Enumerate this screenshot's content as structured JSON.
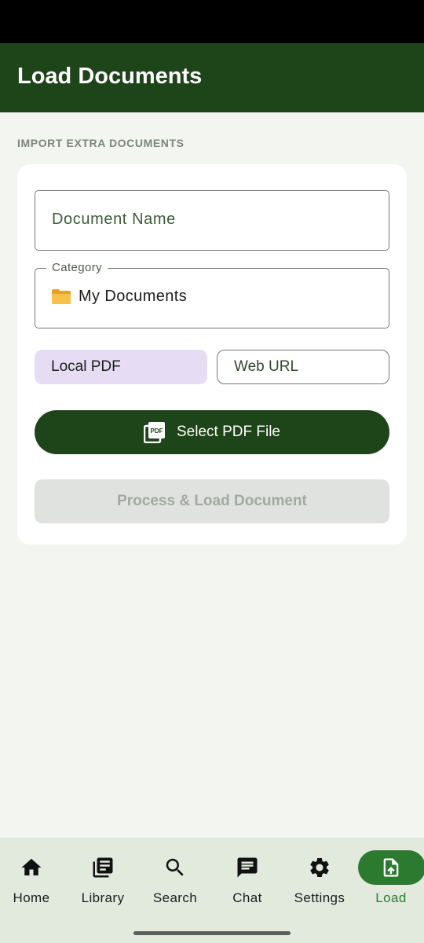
{
  "app_bar": {
    "title": "Load Documents"
  },
  "section": {
    "label": "IMPORT EXTRA DOCUMENTS"
  },
  "form": {
    "document_name_placeholder": "Document Name",
    "category": {
      "label": "Category",
      "value": "My Documents",
      "icon": "folder-icon"
    },
    "source_options": [
      {
        "label": "Local PDF",
        "selected": true
      },
      {
        "label": "Web URL",
        "selected": false
      }
    ],
    "select_button": {
      "label": "Select PDF File",
      "icon": "pdf-file-icon"
    },
    "process_button": {
      "label": "Process & Load Document",
      "enabled": false
    }
  },
  "bottom_nav": {
    "items": [
      {
        "label": "Home",
        "icon": "home-icon",
        "active": false
      },
      {
        "label": "Library",
        "icon": "library-icon",
        "active": false
      },
      {
        "label": "Search",
        "icon": "search-icon",
        "active": false
      },
      {
        "label": "Chat",
        "icon": "chat-icon",
        "active": false
      },
      {
        "label": "Settings",
        "icon": "settings-icon",
        "active": false
      },
      {
        "label": "Load",
        "icon": "upload-file-icon",
        "active": true
      }
    ]
  },
  "colors": {
    "primary_dark": "#1e4419",
    "active_green": "#2b7a30",
    "selected_segment": "#e6ddf5",
    "background": "#f3f5f1",
    "nav_background": "#e2eade"
  }
}
